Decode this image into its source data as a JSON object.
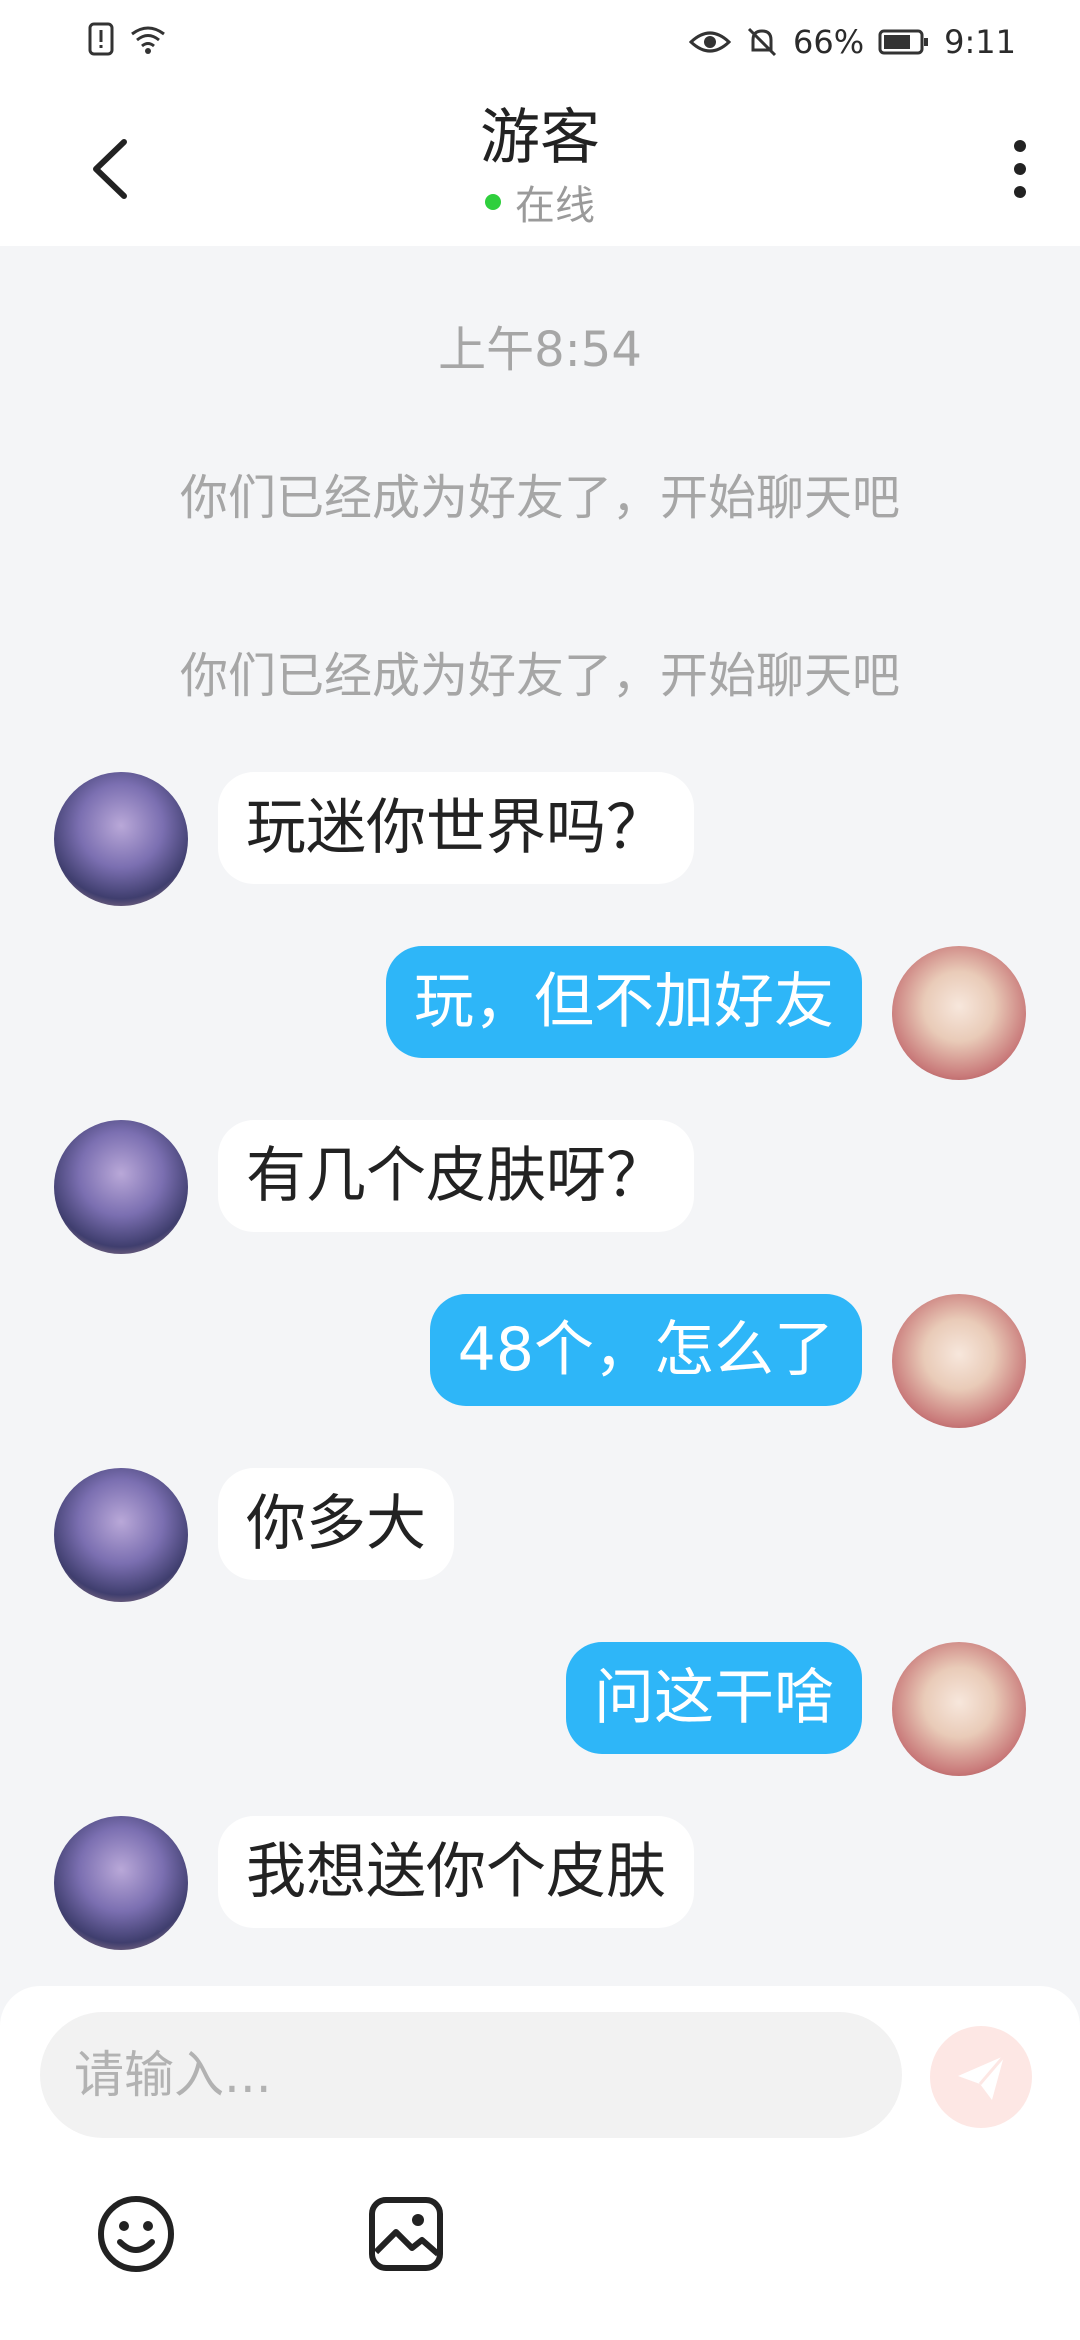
{
  "status_bar": {
    "battery": "66%",
    "time": "9:11"
  },
  "header": {
    "title": "游客",
    "status": "在线"
  },
  "chat": {
    "timestamp": "上午8:54",
    "system_messages": [
      "你们已经成为好友了，开始聊天吧",
      "你们已经成为好友了，开始聊天吧"
    ],
    "messages": [
      {
        "side": "in",
        "text": "玩迷你世界吗？"
      },
      {
        "side": "out",
        "text": "玩，但不加好友"
      },
      {
        "side": "in",
        "text": "有几个皮肤呀？"
      },
      {
        "side": "out",
        "text": "48个，怎么了"
      },
      {
        "side": "in",
        "text": "你多大"
      },
      {
        "side": "out",
        "text": "问这干啥"
      },
      {
        "side": "in",
        "text": "我想送你个皮肤"
      }
    ]
  },
  "composer": {
    "placeholder": "请输入..."
  },
  "colors": {
    "accent": "#2eb6f8",
    "online": "#2fcf3d",
    "background": "#f4f5f7"
  },
  "icons": {
    "back": "chevron-left-icon",
    "more": "more-vertical-icon",
    "send": "send-icon",
    "emoji": "emoji-icon",
    "image": "image-icon"
  }
}
